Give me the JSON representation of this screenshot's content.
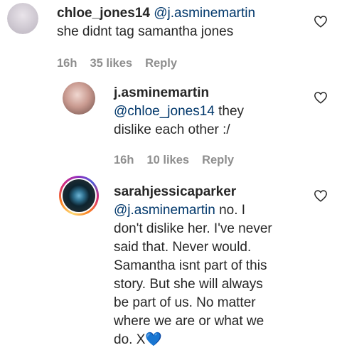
{
  "comments": [
    {
      "username": "chloe_jones14",
      "mention": "@j.asminemartin",
      "text_lines": [
        "she didnt tag samantha jones"
      ],
      "time": "16h",
      "likes": "35 likes",
      "reply": "Reply"
    },
    {
      "username": "j.asminemartin",
      "mention": "@chloe_jones14",
      "text_after_mention": " they",
      "text_lines": [
        "dislike each other :/"
      ],
      "time": "16h",
      "likes": "10 likes",
      "reply": "Reply"
    },
    {
      "username": "sarahjessicaparker",
      "mention": "@j.asminemartin",
      "text_after_mention": " no. I",
      "text_lines": [
        "don't dislike her. I've never",
        "said that. Never would.",
        "Samantha isnt part of this",
        "story. But she will always",
        "be part of us. No matter",
        "where we are or what we",
        "do. X💙"
      ]
    }
  ],
  "icons": {
    "heart": "heart-outline-icon",
    "avatar_story_ring": "gradient-story-ring"
  },
  "colors": {
    "text": "#262626",
    "mention": "#00376b",
    "meta": "#8e8e8e"
  }
}
